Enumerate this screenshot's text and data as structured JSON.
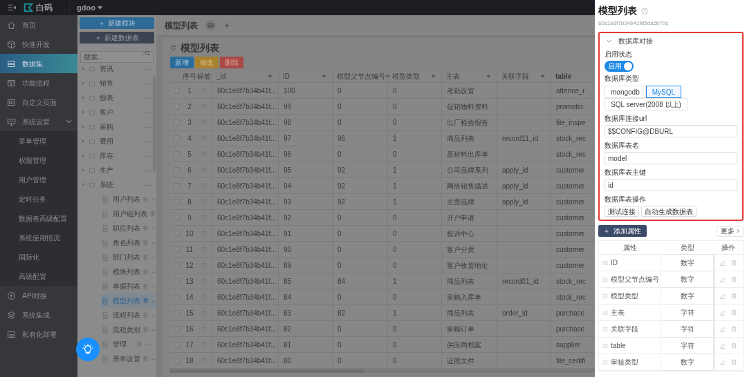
{
  "topbar": {
    "brand": "白码",
    "workspace": "gdoo"
  },
  "sidebar": {
    "items": [
      {
        "label": "首页",
        "selected": false
      },
      {
        "label": "快速开发",
        "selected": false
      },
      {
        "label": "数据集",
        "selected": true
      },
      {
        "label": "功能流程",
        "selected": false
      },
      {
        "label": "自定义页面",
        "selected": false
      },
      {
        "label": "系统设置",
        "selected": false,
        "expanded": true,
        "children": [
          {
            "label": "菜单管理",
            "selected": false
          },
          {
            "label": "权限管理",
            "selected": false
          },
          {
            "label": "用户管理",
            "selected": false
          },
          {
            "label": "定时任务",
            "selected": false
          },
          {
            "label": "数据表高级配置",
            "selected": false
          },
          {
            "label": "系统使用情况",
            "selected": false
          },
          {
            "label": "国际化",
            "selected": false
          },
          {
            "label": "高级配置",
            "selected": false
          }
        ]
      },
      {
        "label": "API对接",
        "selected": false
      },
      {
        "label": "系统集成",
        "selected": false
      },
      {
        "label": "私有化部署",
        "selected": false
      }
    ]
  },
  "tree": {
    "buttons": [
      {
        "label": "新建模块",
        "kind": "primary"
      },
      {
        "label": "新建数据表",
        "kind": "dark"
      }
    ],
    "search": {
      "placeholder": "搜索..."
    },
    "items": [
      {
        "label": "资讯",
        "expanded": false
      },
      {
        "label": "销售",
        "expanded": false
      },
      {
        "label": "报表",
        "expanded": false
      },
      {
        "label": "客户",
        "expanded": false
      },
      {
        "label": "采购",
        "expanded": false
      },
      {
        "label": "费用",
        "expanded": false
      },
      {
        "label": "库存",
        "expanded": false
      },
      {
        "label": "生产",
        "expanded": false
      },
      {
        "label": "系统",
        "expanded": true,
        "children": [
          {
            "label": "用户列表",
            "selected": false
          },
          {
            "label": "用户组列表",
            "selected": false
          },
          {
            "label": "职位列表",
            "selected": false
          },
          {
            "label": "角色列表",
            "selected": false
          },
          {
            "label": "部门列表",
            "selected": false
          },
          {
            "label": "模块列表",
            "selected": false
          },
          {
            "label": "单据列表",
            "selected": false
          },
          {
            "label": "模型列表",
            "selected": true
          },
          {
            "label": "流程列表",
            "selected": false
          },
          {
            "label": "流程类别",
            "selected": false
          },
          {
            "label": "管理",
            "selected": false
          },
          {
            "label": "基本设置",
            "selected": false
          }
        ]
      }
    ]
  },
  "tabs": [
    {
      "label": "模型列表"
    }
  ],
  "page": {
    "title": "模型列表",
    "actions": [
      {
        "label": "新增",
        "kind": "primary"
      },
      {
        "label": "修改",
        "kind": "warning"
      },
      {
        "label": "删除",
        "kind": "danger"
      }
    ]
  },
  "table": {
    "columns": [
      {
        "label": "序号",
        "kind": "index",
        "sortable": false
      },
      {
        "label": "标签",
        "kind": "tag",
        "sortable": false
      },
      {
        "label": "_id",
        "kind": "text",
        "sortable": true
      },
      {
        "label": "ID",
        "kind": "text",
        "sortable": true
      },
      {
        "label": "模型父节点编号",
        "kind": "text",
        "sortable": true
      },
      {
        "label": "模型类型",
        "kind": "text",
        "sortable": true
      },
      {
        "label": "主表",
        "kind": "text",
        "sortable": true
      },
      {
        "label": "关联字段",
        "kind": "text",
        "sortable": true
      },
      {
        "label": "table",
        "kind": "text",
        "sortable": false
      }
    ],
    "rows": [
      {
        "checked": false,
        "cells": [
          "1",
          "",
          "60c1e8f7b34b41f...",
          "100",
          "0",
          "0",
          "考勤设置",
          "",
          "attence_r"
        ]
      },
      {
        "checked": false,
        "cells": [
          "2",
          "",
          "60c1e8f7b34b41f...",
          "99",
          "0",
          "0",
          "促销物料资料",
          "",
          "promotio"
        ]
      },
      {
        "checked": false,
        "cells": [
          "3",
          "",
          "60c1e8f7b34b41f...",
          "98",
          "0",
          "0",
          "出厂检验报告",
          "",
          "file_inspe"
        ]
      },
      {
        "checked": false,
        "cells": [
          "4",
          "",
          "60c1e8f7b34b41f...",
          "97",
          "96",
          "1",
          "商品列表",
          "record11_id",
          "stock_rec"
        ]
      },
      {
        "checked": false,
        "cells": [
          "5",
          "",
          "60c1e8f7b34b41f...",
          "96",
          "0",
          "0",
          "原材料出库单",
          "",
          "stock_rec"
        ]
      },
      {
        "checked": false,
        "cells": [
          "6",
          "",
          "60c1e8f7b34b41f...",
          "95",
          "92",
          "1",
          "公司品牌系列",
          "apply_id",
          "customer"
        ]
      },
      {
        "checked": false,
        "cells": [
          "7",
          "",
          "60c1e8f7b34b41f...",
          "94",
          "92",
          "1",
          "网络销售描述",
          "apply_id",
          "customer"
        ]
      },
      {
        "checked": false,
        "cells": [
          "8",
          "",
          "60c1e8f7b34b41f...",
          "93",
          "92",
          "1",
          "主营品牌",
          "apply_id",
          "customer"
        ]
      },
      {
        "checked": false,
        "cells": [
          "9",
          "",
          "60c1e8f7b34b41f...",
          "92",
          "0",
          "0",
          "开户申请",
          "",
          "customer"
        ]
      },
      {
        "checked": false,
        "cells": [
          "10",
          "",
          "60c1e8f7b34b41f...",
          "91",
          "0",
          "0",
          "投诉中心",
          "",
          "customer"
        ]
      },
      {
        "checked": false,
        "cells": [
          "11",
          "",
          "60c1e8f7b34b41f...",
          "90",
          "0",
          "0",
          "客户分类",
          "",
          "customer"
        ]
      },
      {
        "checked": false,
        "cells": [
          "12",
          "",
          "60c1e8f7b34b41f...",
          "89",
          "0",
          "0",
          "客户收货地址",
          "",
          "customer"
        ]
      },
      {
        "checked": false,
        "cells": [
          "13",
          "",
          "60c1e8f7b34b41f...",
          "85",
          "84",
          "1",
          "商品列表",
          "record01_id",
          "stock_rec"
        ]
      },
      {
        "checked": false,
        "cells": [
          "14",
          "",
          "60c1e8f7b34b41f...",
          "84",
          "0",
          "0",
          "采购入库单",
          "",
          "stock_rec"
        ]
      },
      {
        "checked": false,
        "cells": [
          "15",
          "",
          "60c1e8f7b34b41f...",
          "83",
          "82",
          "1",
          "商品列表",
          "order_id",
          "purchase"
        ]
      },
      {
        "checked": false,
        "cells": [
          "16",
          "",
          "60c1e8f7b34b41f...",
          "82",
          "0",
          "0",
          "采购订单",
          "",
          "purchase"
        ]
      },
      {
        "checked": false,
        "cells": [
          "17",
          "",
          "60c1e8f7b34b41f...",
          "81",
          "0",
          "0",
          "供应商档案",
          "",
          "supplier"
        ]
      },
      {
        "checked": false,
        "cells": [
          "18",
          "",
          "60c1e8f7b34b41f...",
          "80",
          "0",
          "0",
          "证照文件",
          "",
          "file_certifi"
        ]
      }
    ]
  },
  "drawer": {
    "title": "模型列表",
    "record_id": "60c1e8f7b34b41fd5da5b79c",
    "section": {
      "title": "数据库对接",
      "expanded": true,
      "highlighted": true,
      "status": {
        "label": "启用状态",
        "on": true,
        "text": "启用"
      },
      "db_type": {
        "label": "数据库类型",
        "options": [
          {
            "label": "mongodb",
            "selected": false
          },
          {
            "label": "MySQL",
            "selected": true
          },
          {
            "label": "SQL server(2008 以上)",
            "selected": false
          }
        ]
      },
      "fields": [
        {
          "label": "数据库连接url",
          "value": "$$CONFIG@DBURL"
        },
        {
          "label": "数据库表名",
          "value": "model"
        },
        {
          "label": "数据库表主键",
          "value": "id"
        }
      ],
      "operations": {
        "label": "数据库表操作",
        "buttons": [
          "测试连接",
          "自动生成数据表"
        ]
      }
    },
    "add_button": "添加属性",
    "more_button": "更多",
    "attributes": {
      "columns": [
        "属性",
        "类型",
        "操作"
      ],
      "rows": [
        {
          "name": "ID",
          "type": "数字"
        },
        {
          "name": "模型父节点编号",
          "type": "数字"
        },
        {
          "name": "模型类型",
          "type": "数字"
        },
        {
          "name": "主表",
          "type": "字符"
        },
        {
          "name": "关联字段",
          "type": "字符"
        },
        {
          "name": "table",
          "type": "字符"
        },
        {
          "name": "审核类型",
          "type": "数字"
        }
      ]
    }
  }
}
